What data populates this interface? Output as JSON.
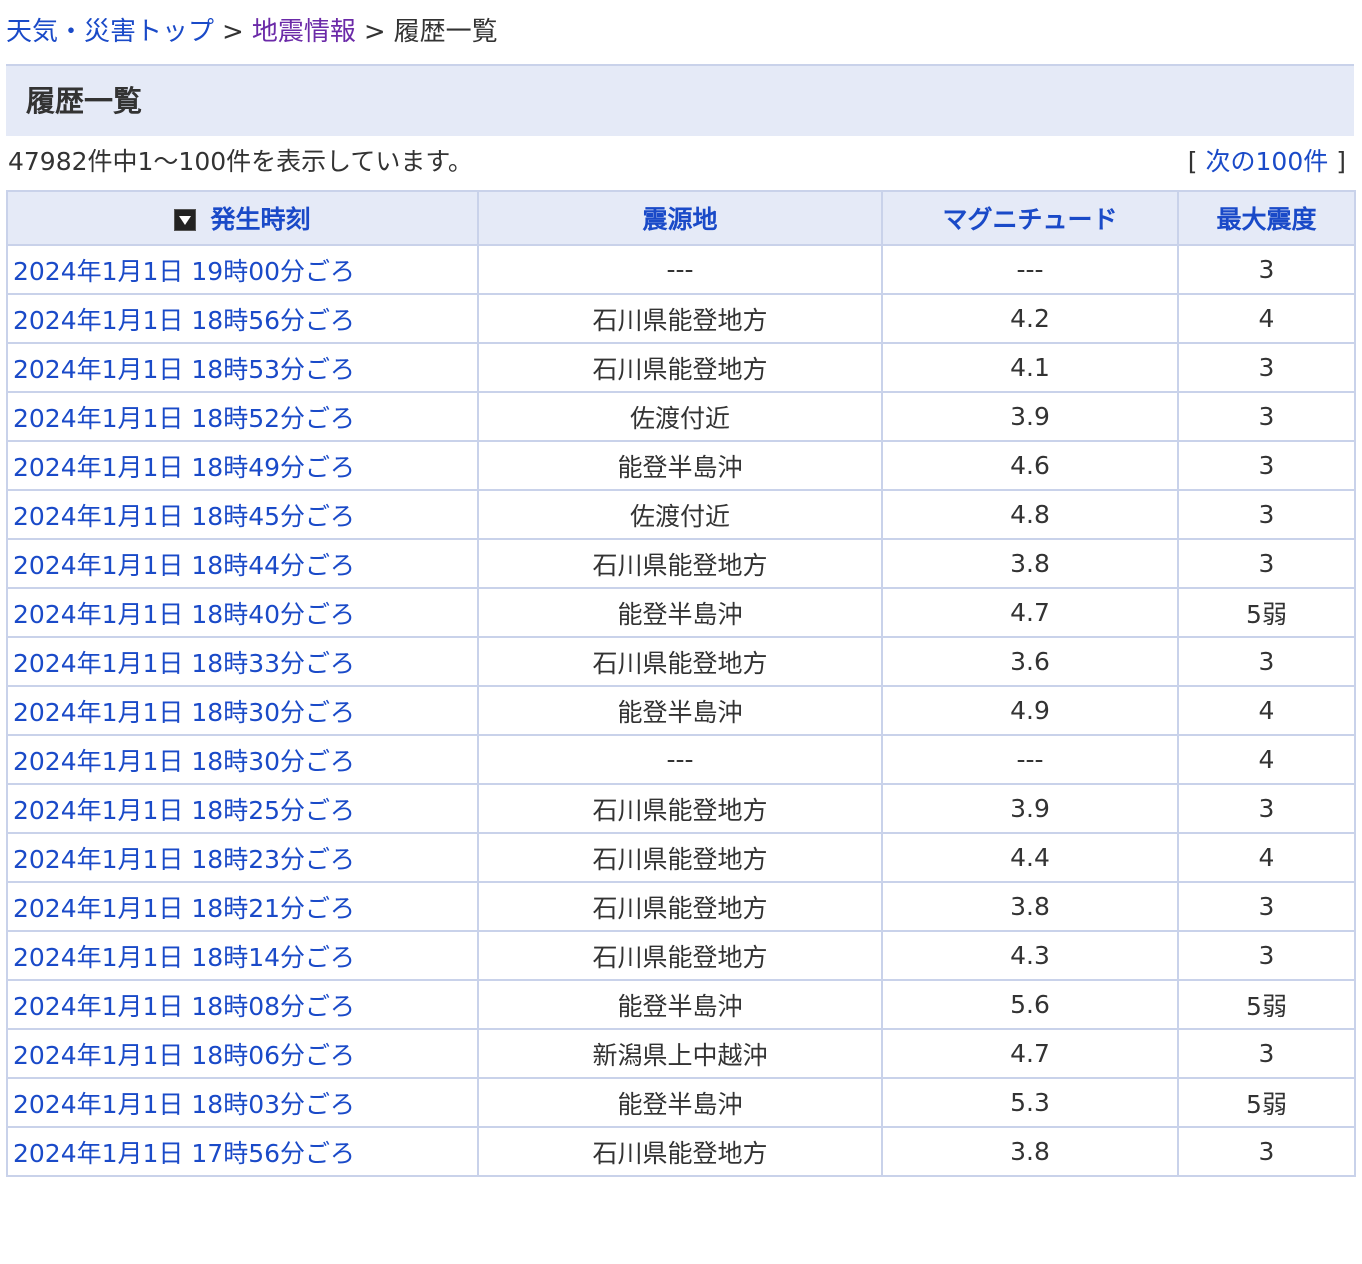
{
  "breadcrumb": {
    "home": "天気・災害トップ",
    "section": "地震情報",
    "current": "履歴一覧",
    "separator": ">"
  },
  "page_title": "履歴一覧",
  "summary": {
    "count_text": "47982件中1〜100件を表示しています。",
    "next_open": "[",
    "next_label": "次の100件",
    "next_close": "]"
  },
  "table": {
    "headers": {
      "time": "発生時刻",
      "epicenter": "震源地",
      "magnitude": "マグニチュード",
      "intensity": "最大震度"
    },
    "sort_icon": "sort-descending-icon",
    "rows": [
      {
        "time": "2024年1月1日 19時00分ごろ",
        "epicenter": "---",
        "magnitude": "---",
        "intensity": "3"
      },
      {
        "time": "2024年1月1日 18時56分ごろ",
        "epicenter": "石川県能登地方",
        "magnitude": "4.2",
        "intensity": "4"
      },
      {
        "time": "2024年1月1日 18時53分ごろ",
        "epicenter": "石川県能登地方",
        "magnitude": "4.1",
        "intensity": "3"
      },
      {
        "time": "2024年1月1日 18時52分ごろ",
        "epicenter": "佐渡付近",
        "magnitude": "3.9",
        "intensity": "3"
      },
      {
        "time": "2024年1月1日 18時49分ごろ",
        "epicenter": "能登半島沖",
        "magnitude": "4.6",
        "intensity": "3"
      },
      {
        "time": "2024年1月1日 18時45分ごろ",
        "epicenter": "佐渡付近",
        "magnitude": "4.8",
        "intensity": "3"
      },
      {
        "time": "2024年1月1日 18時44分ごろ",
        "epicenter": "石川県能登地方",
        "magnitude": "3.8",
        "intensity": "3"
      },
      {
        "time": "2024年1月1日 18時40分ごろ",
        "epicenter": "能登半島沖",
        "magnitude": "4.7",
        "intensity": "5弱"
      },
      {
        "time": "2024年1月1日 18時33分ごろ",
        "epicenter": "石川県能登地方",
        "magnitude": "3.6",
        "intensity": "3"
      },
      {
        "time": "2024年1月1日 18時30分ごろ",
        "epicenter": "能登半島沖",
        "magnitude": "4.9",
        "intensity": "4"
      },
      {
        "time": "2024年1月1日 18時30分ごろ",
        "epicenter": "---",
        "magnitude": "---",
        "intensity": "4"
      },
      {
        "time": "2024年1月1日 18時25分ごろ",
        "epicenter": "石川県能登地方",
        "magnitude": "3.9",
        "intensity": "3"
      },
      {
        "time": "2024年1月1日 18時23分ごろ",
        "epicenter": "石川県能登地方",
        "magnitude": "4.4",
        "intensity": "4"
      },
      {
        "time": "2024年1月1日 18時21分ごろ",
        "epicenter": "石川県能登地方",
        "magnitude": "3.8",
        "intensity": "3"
      },
      {
        "time": "2024年1月1日 18時14分ごろ",
        "epicenter": "石川県能登地方",
        "magnitude": "4.3",
        "intensity": "3"
      },
      {
        "time": "2024年1月1日 18時08分ごろ",
        "epicenter": "能登半島沖",
        "magnitude": "5.6",
        "intensity": "5弱"
      },
      {
        "time": "2024年1月1日 18時06分ごろ",
        "epicenter": "新潟県上中越沖",
        "magnitude": "4.7",
        "intensity": "3"
      },
      {
        "time": "2024年1月1日 18時03分ごろ",
        "epicenter": "能登半島沖",
        "magnitude": "5.3",
        "intensity": "5弱"
      },
      {
        "time": "2024年1月1日 17時56分ごろ",
        "epicenter": "石川県能登地方",
        "magnitude": "3.8",
        "intensity": "3"
      }
    ]
  }
}
